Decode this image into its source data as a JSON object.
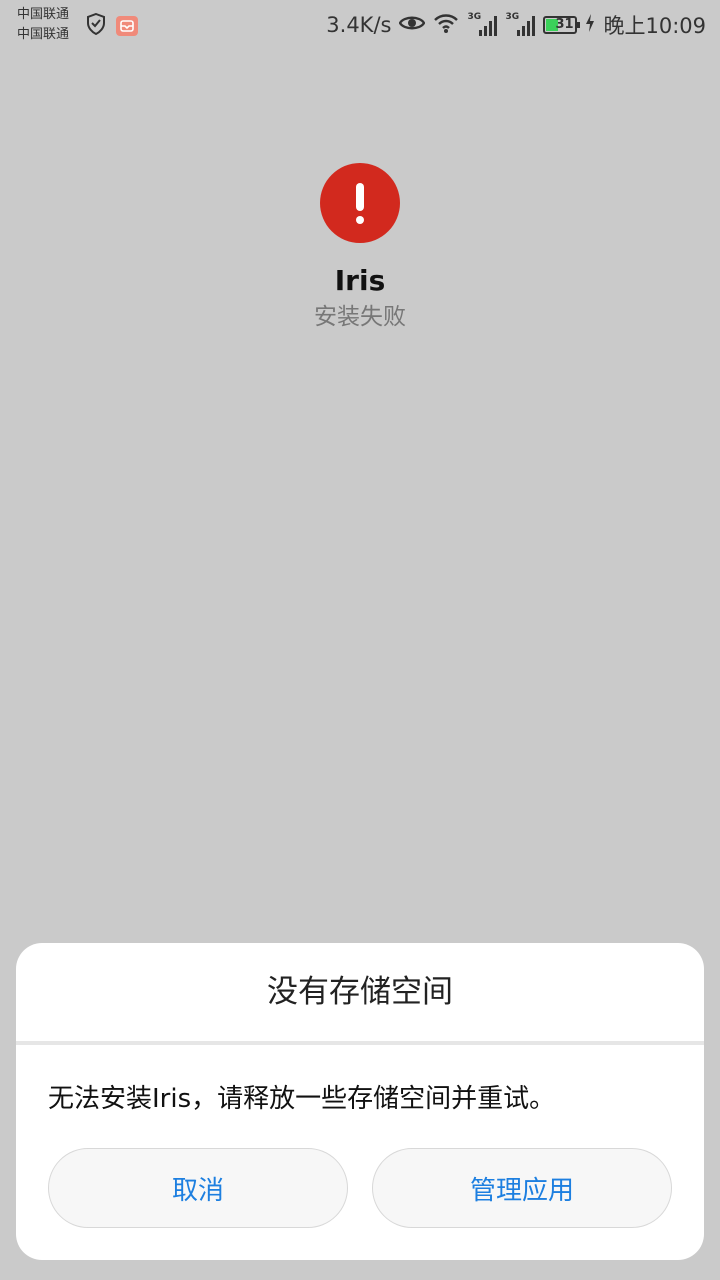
{
  "status_bar": {
    "carrier_1": "中国联通",
    "carrier_2": "中国联通",
    "net_speed": "3.4K/s",
    "battery_level": "31",
    "time": "晚上10:09",
    "signal_1_label": "3G",
    "signal_2_label": "3G"
  },
  "app": {
    "name": "Iris",
    "status": "安装失败",
    "error_color": "#d2291e"
  },
  "dialog": {
    "title": "没有存储空间",
    "message": "无法安装Iris，请释放一些存储空间并重试。",
    "cancel_label": "取消",
    "manage_label": "管理应用",
    "button_text_color": "#1d7fe0"
  }
}
